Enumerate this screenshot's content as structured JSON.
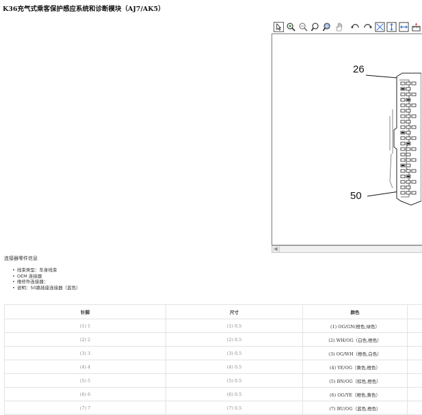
{
  "title": "K36充气式乘客保护感应系统和诊断模块（AJ7/AK5）",
  "viewer": {
    "toolbar": [
      {
        "name": "select-arrow-icon"
      },
      {
        "name": "zoom-in-icon"
      },
      {
        "name": "zoom-out-icon"
      },
      {
        "name": "zoom-window-icon"
      },
      {
        "name": "zoom-region-icon"
      },
      {
        "name": "pan-hand-icon"
      },
      {
        "name": "rotate-left-icon"
      },
      {
        "name": "rotate-right-icon"
      },
      {
        "name": "fit-window-icon"
      },
      {
        "name": "fit-height-icon"
      },
      {
        "name": "fit-width-icon"
      },
      {
        "name": "measure-icon"
      }
    ],
    "pin_labels": {
      "top": "26",
      "bottom": "50"
    }
  },
  "info": {
    "heading": "连接器零件信息",
    "items": [
      "线束类型：车身线束",
      "OEM 连接器",
      "维修件连接器：",
      "说明：50路插座连接器（蓝色）"
    ]
  },
  "table": {
    "headers": [
      "针脚",
      "尺寸",
      "颜色",
      ""
    ],
    "rows": [
      {
        "pin": "(1) 1",
        "size": "(1) 0.5",
        "color": "(1) OG/GN(橙色,绿色）"
      },
      {
        "pin": "(2) 2",
        "size": "(2) 0.5",
        "color": "(2) WH/OG（白色,橙色）"
      },
      {
        "pin": "(3) 3",
        "size": "(3) 0.5",
        "color": "(3) OG/WH（橙色,白色）"
      },
      {
        "pin": "(4) 4",
        "size": "(4) 0.5",
        "color": "(4) YE/OG（黄色,橙色）"
      },
      {
        "pin": "(5) 5",
        "size": "(5) 0.5",
        "color": "(5) BN/OG（棕色,橙色）"
      },
      {
        "pin": "(6) 6",
        "size": "(6) 0.5",
        "color": "(6) OG/YE（橙色,黄色）"
      },
      {
        "pin": "(7) 7",
        "size": "(7) 0.5",
        "color": "(7) BU/OG（蓝色,橙色）"
      }
    ]
  }
}
